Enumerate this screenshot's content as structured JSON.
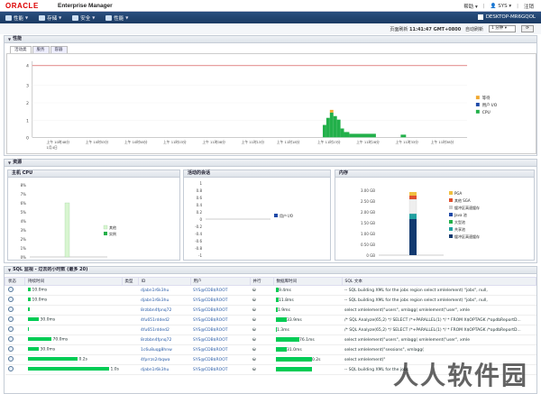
{
  "header": {
    "logo": "ORACLE",
    "app_title": "Enterprise Manager",
    "help_label": "帮助",
    "user_label": "SYS",
    "logout_label": "注销"
  },
  "menu": {
    "items": [
      {
        "label": "性能"
      },
      {
        "label": "存储"
      },
      {
        "label": "安全"
      },
      {
        "label": "性能"
      }
    ],
    "host": "DESKTOP-MR6GQOL"
  },
  "refresh": {
    "label": "页面刷新",
    "time": "11:41:47 GMT+0800",
    "auto_label": "自动刷新",
    "interval": "1 分钟"
  },
  "performance": {
    "title": "性能",
    "tabs": [
      "活动类",
      "服务",
      "容器"
    ],
    "yticks": [
      "4",
      "3",
      "2",
      "1",
      "0"
    ],
    "xticks": [
      "上午 10时48分\n1月4日",
      "上午 10时53分",
      "上午 10时58分",
      "上午 11时03分",
      "上午 11时08分",
      "上午 11时13分",
      "上午 11时18分",
      "上午 11时23分",
      "上午 11时28分",
      "上午 11时33分",
      "上午 11时38分"
    ],
    "legend": [
      {
        "name": "等待",
        "color": "#f0a830"
      },
      {
        "name": "用户 I/O",
        "color": "#1f4aa8"
      },
      {
        "name": "CPU",
        "color": "#22b04a"
      }
    ]
  },
  "resources": {
    "title": "资源",
    "host_cpu": {
      "title": "主机 CPU",
      "yticks": [
        "8%",
        "7%",
        "6%",
        "5%",
        "4%",
        "3%",
        "2%",
        "1%",
        "0%"
      ],
      "legend": [
        {
          "name": "其他",
          "color": "#d8f5d0"
        },
        {
          "name": "实例",
          "color": "#22b04a"
        }
      ]
    },
    "active_sessions": {
      "title": "活动的会话",
      "yticks": [
        "1",
        "0.8",
        "0.6",
        "0.4",
        "0.2",
        "0",
        "-0.2",
        "-0.4",
        "-0.6",
        "-0.8",
        "-1"
      ],
      "legend": [
        {
          "name": "用户 I/O",
          "color": "#1f4aa8"
        }
      ]
    },
    "memory": {
      "title": "内存",
      "yticks": [
        "3.00 GB",
        "2.50 GB",
        "2.00 GB",
        "1.50 GB",
        "1.00 GB",
        "0.50 GB",
        "0 GB"
      ],
      "legend": [
        {
          "name": "PGA",
          "color": "#f0c040"
        },
        {
          "name": "其他 SGA",
          "color": "#e05030"
        },
        {
          "name": "缓冲区高速缓存",
          "color": "#ccc"
        },
        {
          "name": "Java 池",
          "color": "#1f4aa8"
        },
        {
          "name": "大型池",
          "color": "#22b04a"
        },
        {
          "name": "共享池",
          "color": "#20a0a0"
        },
        {
          "name": "缓冲区高速缓存",
          "color": "#123a70"
        }
      ]
    }
  },
  "sql": {
    "title": "SQL 监视 - 过去的小时数 (最多 20)",
    "columns": [
      "状态",
      "持续时间",
      "类型",
      "ID",
      "用户",
      "并行",
      "数据库时间",
      "SQL 文本"
    ],
    "rows": [
      {
        "duration": "10.0ms",
        "id": "djabn1r6k3hu",
        "user": "SYS@CDB$ROOT",
        "dbtime": "9.4ms",
        "text": "-- SQL building XML for the jobs region    select    xmlelement(     \"jobs\",     null,"
      },
      {
        "duration": "10.0ms",
        "id": "djabn1r6k3hu",
        "user": "SYS@CDB$ROOT",
        "dbtime": "11.8ms",
        "text": "-- SQL building XML for the jobs region    select    xmlelement(     \"jobs\",     null,"
      },
      {
        "duration": "",
        "id": "8rzbbn4fpnq72",
        "user": "SYS@CDB$ROOT",
        "dbtime": "1.9ms",
        "text": "select    xmlelement(\"users\",    xmlagg(    xmlelement(\"user\",    xmle"
      },
      {
        "duration": "30.0ms",
        "id": "4fu651rdded2",
        "user": "SYS@CDB$ROOT",
        "dbtime": "33.9ms",
        "text": "/* SQL Analyze(65,2) */ SELECT /*+PARALLEL(1) */ * FROM X$OPTAGK /*opdbReportD..."
      },
      {
        "duration": "",
        "id": "4fu651rdded2",
        "user": "SYS@CDB$ROOT",
        "dbtime": "1.3ms",
        "text": "/* SQL Analyze(65,2) */ SELECT /*+PARALLEL(1) */ * FROM X$OPTAGK /*opdbReportD..."
      },
      {
        "duration": "70.0ms",
        "id": "8rzbbn4fpnq72",
        "user": "SYS@CDB$ROOT",
        "dbtime": "76.1ms",
        "text": "select    xmlelement(\"users\",    xmlagg(    xmlelement(\"user\",    xmle"
      },
      {
        "duration": "30.0ms",
        "id": "1c6u8uqg8hnw",
        "user": "SYS@CDB$ROOT",
        "dbtime": "31.0ms",
        "text": "select    xmlelement(\"sessions\",    xmlagg("
      },
      {
        "duration": "0.2s",
        "id": "4fprrzs2rbqwa",
        "user": "SYS@CDB$ROOT",
        "dbtime": "0.2s",
        "text": "select    xmlelement(\"    "
      },
      {
        "duration": "1.0s",
        "id": "djabn1r6k3hu",
        "user": "SYS@CDB$ROOT",
        "dbtime": "",
        "text": "-- SQL building XML for the jobs    "
      }
    ]
  },
  "watermark": "人人软件园"
}
